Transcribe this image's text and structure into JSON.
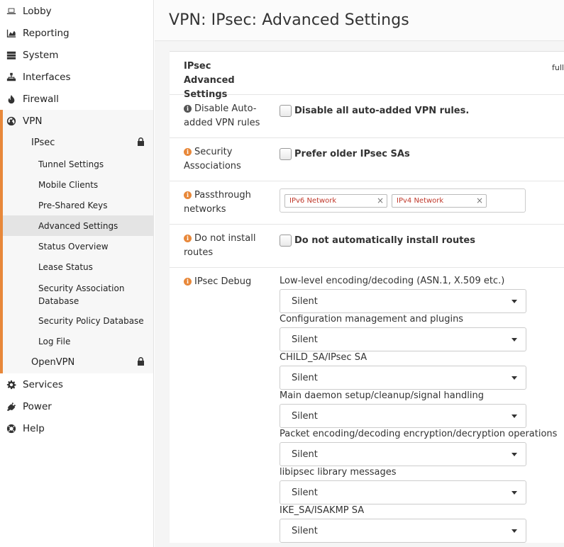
{
  "sidebar": {
    "top_items": [
      {
        "label": "Lobby",
        "icon": "laptop-icon"
      },
      {
        "label": "Reporting",
        "icon": "area-chart-icon"
      },
      {
        "label": "System",
        "icon": "server-icon"
      },
      {
        "label": "Interfaces",
        "icon": "sitemap-icon"
      },
      {
        "label": "Firewall",
        "icon": "fire-icon"
      }
    ],
    "vpn": {
      "label": "VPN",
      "ipsec_label": "IPsec",
      "ipsec_children": [
        "Tunnel Settings",
        "Mobile Clients",
        "Pre-Shared Keys",
        "Advanced Settings",
        "Status Overview",
        "Lease Status",
        "Security Association Database",
        "Security Policy Database",
        "Log File"
      ],
      "active_child": "Advanced Settings",
      "openvpn_label": "OpenVPN"
    },
    "bottom_items": [
      {
        "label": "Services",
        "icon": "gear-icon"
      },
      {
        "label": "Power",
        "icon": "plug-icon"
      },
      {
        "label": "Help",
        "icon": "lifebuoy-icon"
      }
    ]
  },
  "page": {
    "title": "VPN: IPsec: Advanced Settings"
  },
  "panel": {
    "header_label": "IPsec Advanced Settings",
    "header_right": "full",
    "rows": {
      "disable_auto": {
        "label": "Disable Auto-added VPN rules",
        "checkbox_label": "Disable all auto-added VPN rules."
      },
      "security_assoc": {
        "label": "Security Associations",
        "checkbox_label": "Prefer older IPsec SAs"
      },
      "passthrough": {
        "label": "Passthrough networks",
        "tags": [
          "IPv6 Network",
          "IPv4 Network"
        ]
      },
      "no_routes": {
        "label": "Do not install routes",
        "checkbox_label": "Do not automatically install routes"
      },
      "debug": {
        "label": "IPsec Debug",
        "items": [
          {
            "label": "Low-level encoding/decoding (ASN.1, X.509 etc.)",
            "value": "Silent"
          },
          {
            "label": "Configuration management and plugins",
            "value": "Silent"
          },
          {
            "label": "CHILD_SA/IPsec SA",
            "value": "Silent"
          },
          {
            "label": "Main daemon setup/cleanup/signal handling",
            "value": "Silent"
          },
          {
            "label": "Packet encoding/decoding encryption/decryption operations",
            "value": "Silent"
          },
          {
            "label": "libipsec library messages",
            "value": "Silent"
          },
          {
            "label": "IKE_SA/ISAKMP SA",
            "value": "Silent"
          }
        ]
      }
    }
  },
  "colors": {
    "accent": "#e8883a",
    "tag_text": "#c0392b"
  }
}
